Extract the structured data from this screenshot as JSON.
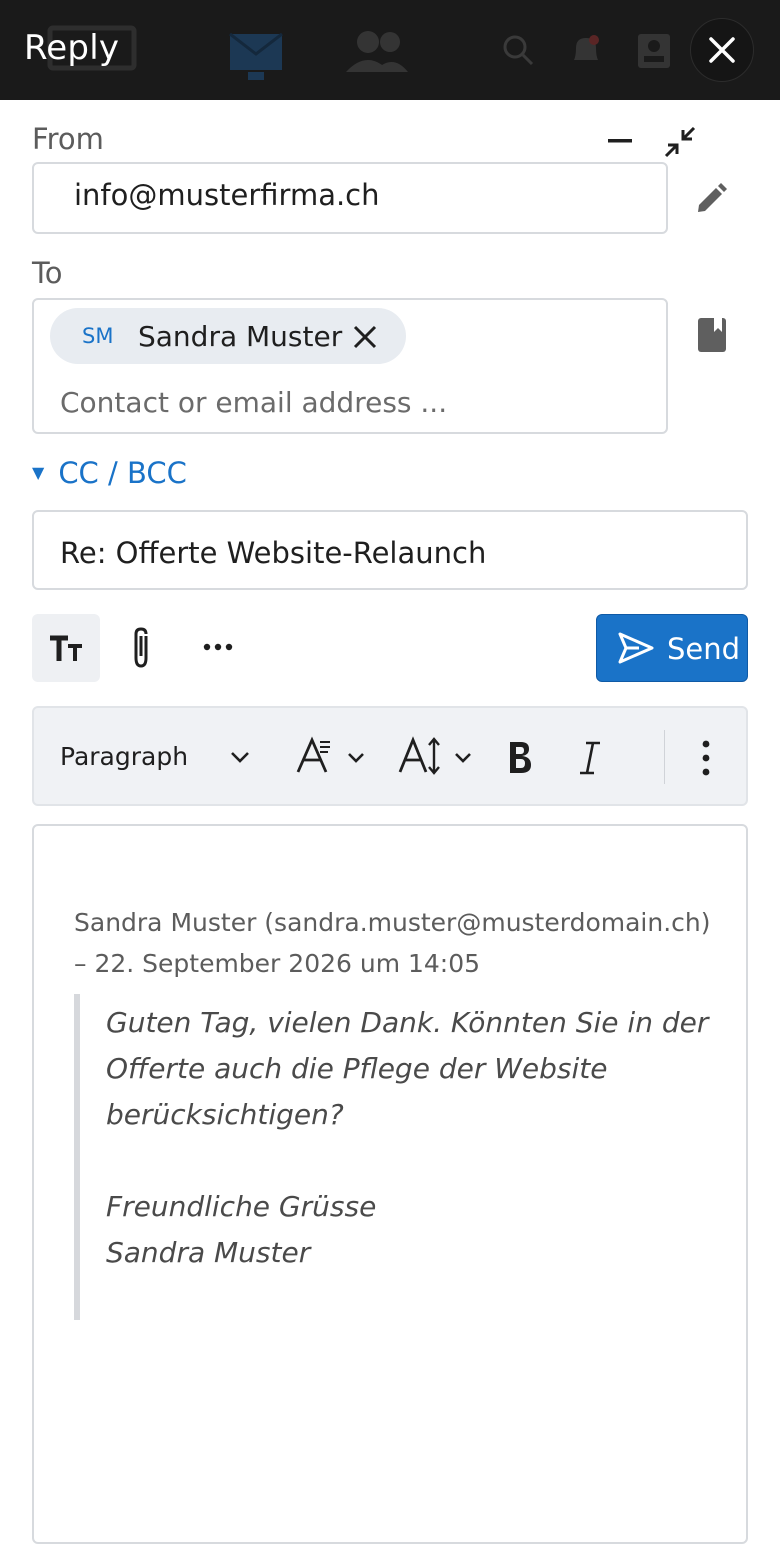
{
  "header": {
    "title": "Reply"
  },
  "from": {
    "label": "From",
    "value": "info@musterfirma.ch"
  },
  "to": {
    "label": "To",
    "recipient": {
      "initials": "SM",
      "name": "Sandra Muster"
    },
    "placeholder": "Contact or email address ..."
  },
  "cc_bcc": {
    "label": "CC / BCC"
  },
  "subject": {
    "value": "Re: Offerte Website-Relaunch"
  },
  "actions": {
    "send_label": "Send"
  },
  "editor_toolbar": {
    "block_style": "Paragraph"
  },
  "quoted": {
    "meta_line1": "Sandra Muster (sandra.muster@musterdomain.ch)",
    "meta_line2": "– 22. September 2026 um 14:05",
    "body_line1": "Guten Tag, vielen Dank. Könnten Sie in der",
    "body_line2": "Offerte auch die Pflege der Website",
    "body_line3": "berücksichtigen?",
    "closing_line1": "Freundliche Grüsse",
    "closing_line2": "Sandra Muster"
  },
  "colors": {
    "accent": "#1a73c8",
    "topbar": "#1a1a1a",
    "chip": "#e8ecf1"
  }
}
